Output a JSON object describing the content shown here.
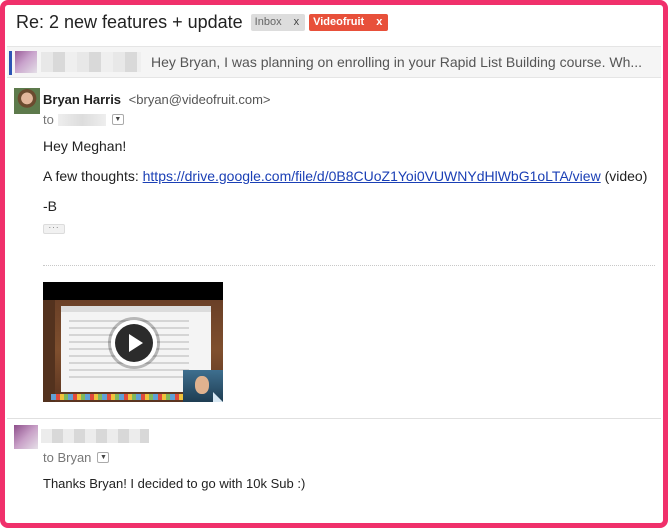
{
  "thread": {
    "subject": "Re: 2 new features + update",
    "labels": [
      {
        "text": "Inbox",
        "close": "x"
      },
      {
        "text": "Videofruit",
        "close": "x"
      }
    ]
  },
  "collapsed_message": {
    "snippet": "Hey Bryan, I was planning on enrolling in your Rapid List Building course. Wh..."
  },
  "message1": {
    "sender_name": "Bryan Harris",
    "sender_email": "<bryan@videofruit.com>",
    "to_prefix": "to",
    "greeting": "Hey Meghan!",
    "thoughts_prefix": "A few thoughts: ",
    "link_text": "https://drive.google.com/file/d/0B8CUoZ1Yoi0VUWNYdHlWbG1oLTA/view",
    "link_suffix": " (video)",
    "signoff": "-B",
    "dots": "···"
  },
  "message2": {
    "to_line": "to Bryan",
    "body": "Thanks Bryan! I decided to go with 10k Sub :)"
  },
  "colors": {
    "frame": "#f0306b",
    "videofruit_label": "#e8503a",
    "link": "#1a3fb5"
  }
}
